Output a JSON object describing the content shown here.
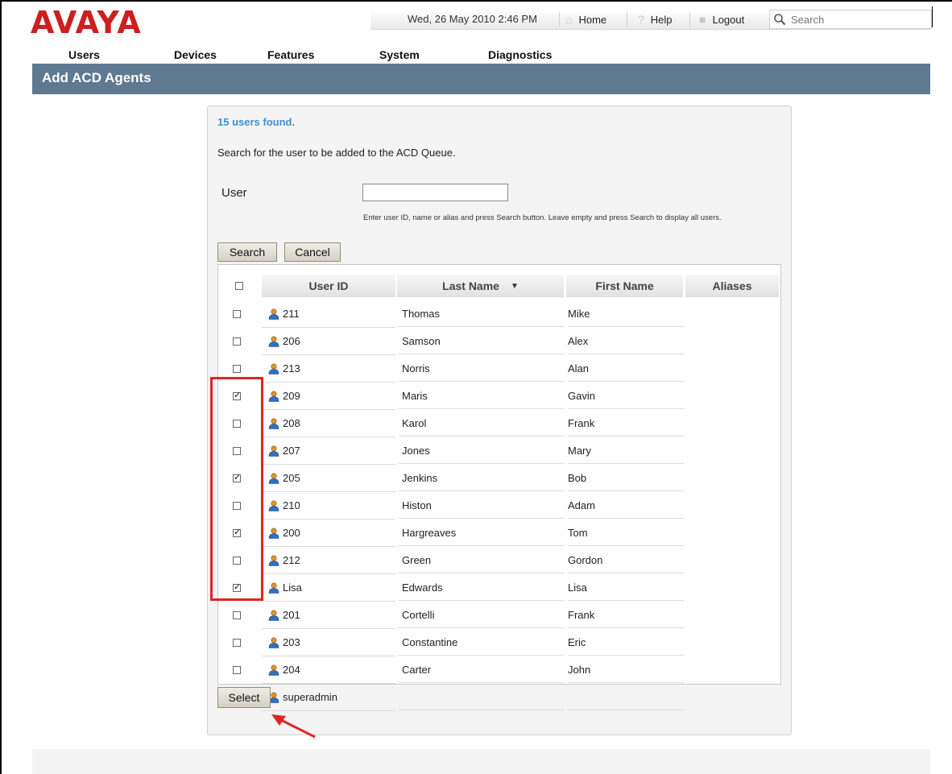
{
  "logo": "AVAYA",
  "topbar": {
    "datetime": "Wed, 26 May 2010 2:46 PM",
    "home": "Home",
    "help": "Help",
    "logout": "Logout",
    "search_placeholder": "Search"
  },
  "menu": [
    "Users",
    "Devices",
    "Features",
    "System",
    "Diagnostics"
  ],
  "page_title": "Add ACD Agents",
  "panel": {
    "found_text": "15 users found.",
    "instructions": "Search for the user to be added to the ACD Queue.",
    "user_label": "User",
    "user_value": "",
    "hint": "Enter user ID, name or alias and press Search button. Leave empty and press Search to display all users.",
    "search_button": "Search",
    "cancel_button": "Cancel",
    "select_button": "Select"
  },
  "table": {
    "columns": [
      "User ID",
      "Last Name",
      "First Name",
      "Aliases"
    ],
    "sorted_column": "Last Name",
    "sort_direction": "descending",
    "rows": [
      {
        "user_id": "211",
        "last": "Thomas",
        "first": "Mike",
        "checked": false
      },
      {
        "user_id": "206",
        "last": "Samson",
        "first": "Alex",
        "checked": false
      },
      {
        "user_id": "213",
        "last": "Norris",
        "first": "Alan",
        "checked": false
      },
      {
        "user_id": "209",
        "last": "Maris",
        "first": "Gavin",
        "checked": true
      },
      {
        "user_id": "208",
        "last": "Karol",
        "first": "Frank",
        "checked": false
      },
      {
        "user_id": "207",
        "last": "Jones",
        "first": "Mary",
        "checked": false
      },
      {
        "user_id": "205",
        "last": "Jenkins",
        "first": "Bob",
        "checked": true
      },
      {
        "user_id": "210",
        "last": "Histon",
        "first": "Adam",
        "checked": false
      },
      {
        "user_id": "200",
        "last": "Hargreaves",
        "first": "Tom",
        "checked": true
      },
      {
        "user_id": "212",
        "last": "Green",
        "first": "Gordon",
        "checked": false
      },
      {
        "user_id": "Lisa",
        "last": "Edwards",
        "first": "Lisa",
        "checked": true
      },
      {
        "user_id": "201",
        "last": "Cortelli",
        "first": "Frank",
        "checked": false
      },
      {
        "user_id": "203",
        "last": "Constantine",
        "first": "Eric",
        "checked": false
      },
      {
        "user_id": "204",
        "last": "Carter",
        "first": "John",
        "checked": false
      },
      {
        "user_id": "superadmin",
        "last": "",
        "first": "",
        "checked": false
      }
    ]
  },
  "colors": {
    "brand_red": "#cc1f1f",
    "title_bar": "#5f7990",
    "found_blue": "#3e8fd6",
    "annotation_red": "#e02424"
  },
  "icons": {
    "home": "home-icon",
    "help": "help-icon",
    "logout": "lock-icon",
    "search": "search-icon",
    "user": "user-icon",
    "sort": "sort-down-icon"
  }
}
